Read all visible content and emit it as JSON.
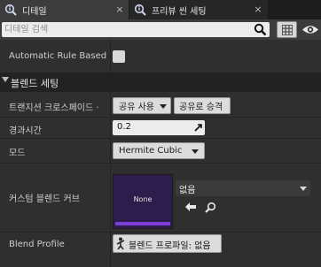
{
  "tabs": [
    {
      "label": "디테일",
      "close": "×",
      "icon": "magnifier-info-icon"
    },
    {
      "label": "프리뷰 씬 세팅",
      "close": "×",
      "icon": "magnifier-info-icon"
    }
  ],
  "search": {
    "placeholder": "디테일 검색",
    "value": ""
  },
  "properties": {
    "automatic_rule_based": {
      "label": "Automatic Rule Based",
      "checked": false
    },
    "category": {
      "label": "블렌드 세팅"
    },
    "transition_crossfade": {
      "label": "트랜지션 크로스페이드 ·",
      "shared_button": "공유 사용",
      "promote_button": "공유로 승격"
    },
    "duration": {
      "label": "경과시간",
      "value": "0.2"
    },
    "mode": {
      "label": "모드",
      "value": "Hermite Cubic"
    },
    "custom_blend_curve": {
      "label": "커스텀 블렌드 커브",
      "thumbnail_text": "None",
      "asset_value": "없음"
    },
    "blend_profile": {
      "label": "Blend Profile",
      "button_label": "블렌드 프로파일: 없음"
    }
  },
  "colors": {
    "panel_bg": "#2f2f2f",
    "tab_active": "#3c3c3c",
    "category_bg": "#222222",
    "curve_thumb_bg": "#2c1d4d",
    "curve_accent": "#7b3fd6"
  }
}
